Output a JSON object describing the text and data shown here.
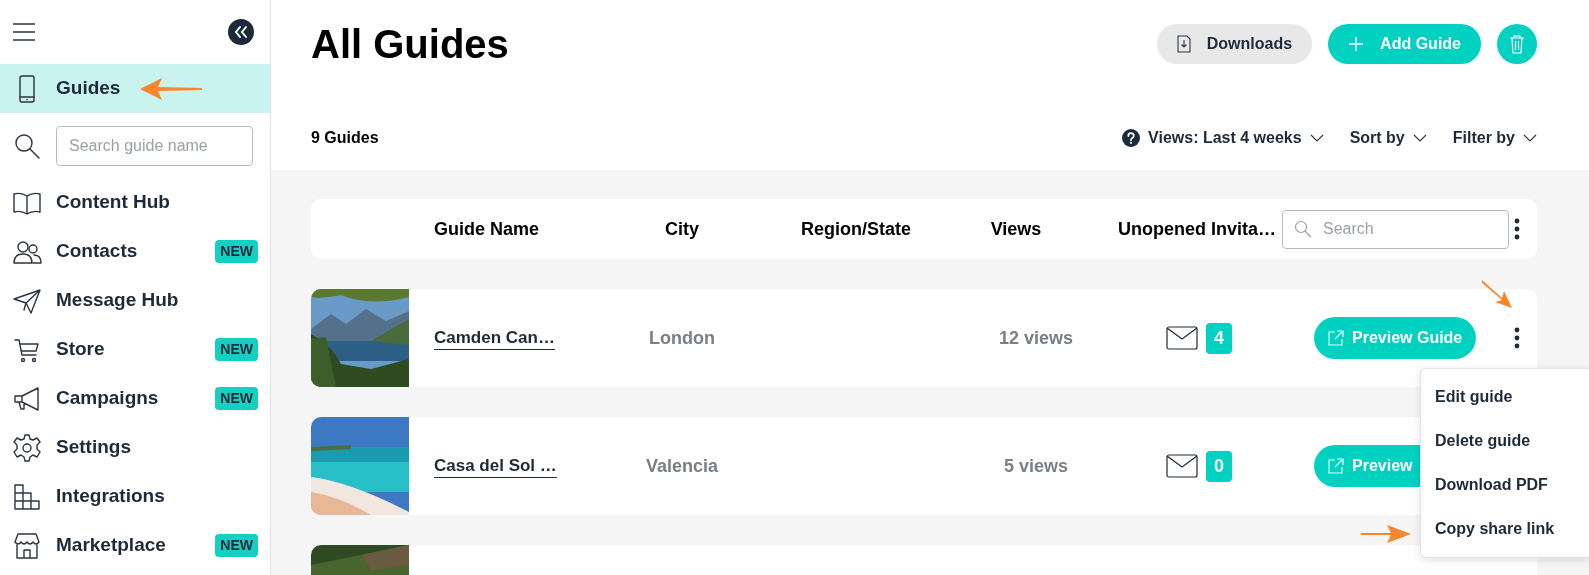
{
  "sidebar": {
    "items": [
      {
        "kind": "nav",
        "label": "Guides",
        "selected": true
      },
      {
        "kind": "search",
        "placeholder": "Search guide name"
      },
      {
        "kind": "nav",
        "label": "Content Hub",
        "selected": false
      },
      {
        "kind": "nav",
        "label": "Contacts",
        "selected": false,
        "badge": "NEW"
      },
      {
        "kind": "nav",
        "label": "Message Hub",
        "selected": false
      },
      {
        "kind": "nav",
        "label": "Store",
        "selected": false,
        "badge": "NEW"
      },
      {
        "kind": "nav",
        "label": "Campaigns",
        "selected": false,
        "badge": "NEW"
      },
      {
        "kind": "nav",
        "label": "Settings",
        "selected": false
      },
      {
        "kind": "nav",
        "label": "Integrations",
        "selected": false
      },
      {
        "kind": "nav",
        "label": "Marketplace",
        "selected": false,
        "badge": "NEW"
      }
    ]
  },
  "header": {
    "title": "All Guides",
    "buttons": [
      {
        "kind": "secondary",
        "label": "Downloads"
      },
      {
        "kind": "primary",
        "label": "Add Guide"
      },
      {
        "kind": "icon"
      }
    ]
  },
  "toolbar": {
    "count": "9 Guides",
    "views": "Views: Last 4 weeks",
    "sort": "Sort by",
    "filter": "Filter by"
  },
  "table": {
    "columns": [
      "Guide Name",
      "City",
      "Region/State",
      "Views",
      "Unopened Invita…"
    ],
    "search": {
      "placeholder": "Search"
    },
    "rows": [
      {
        "kind": "full",
        "name": "Camden Can…",
        "city": "London",
        "views": "12 views",
        "unopened": "4",
        "action": "Preview Guide"
      },
      {
        "kind": "full",
        "name": "Casa del Sol …",
        "city": "Valencia",
        "views": "5 views",
        "unopened": "0",
        "action": "Preview"
      },
      {
        "kind": "partial"
      }
    ]
  },
  "context_menu": {
    "items": [
      "Edit guide",
      "Delete guide",
      "Download PDF",
      "Copy share link"
    ]
  }
}
